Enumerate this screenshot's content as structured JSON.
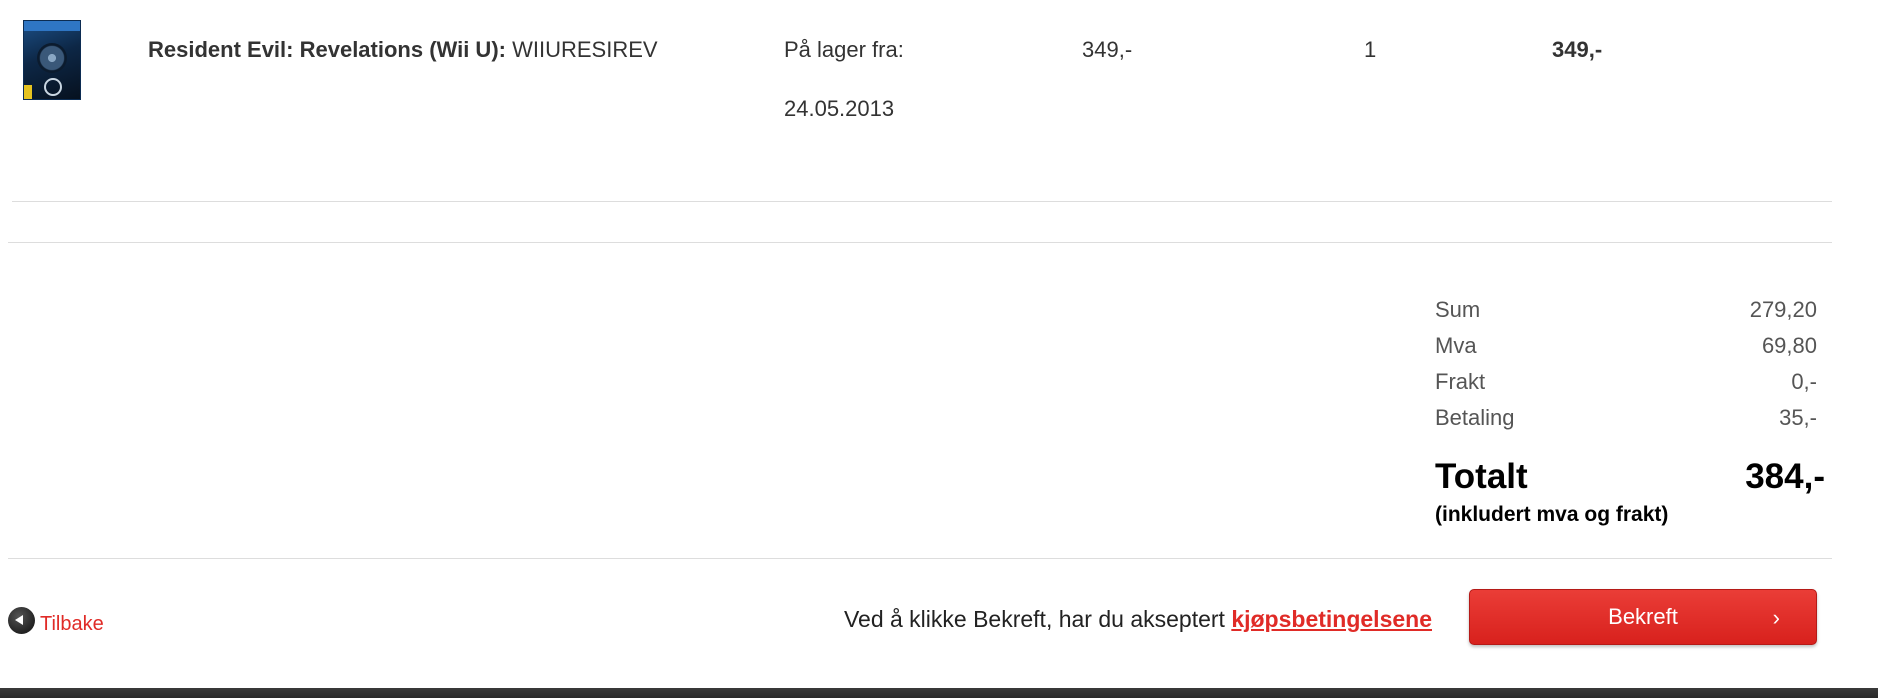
{
  "cart": {
    "item": {
      "name": "Resident Evil: Revelations (Wii U):",
      "sku": "WIIURESIREV",
      "stock_label": "På lager fra:",
      "stock_date": "24.05.2013",
      "unit_price": "349,-",
      "quantity": "1",
      "line_total": "349,-"
    }
  },
  "summary": {
    "rows": [
      {
        "label": "Sum",
        "value": "279,20"
      },
      {
        "label": "Mva",
        "value": "69,80"
      },
      {
        "label": "Frakt",
        "value": "0,-"
      },
      {
        "label": "Betaling",
        "value": "35,-"
      }
    ],
    "total_label": "Totalt",
    "total_value": "384,-",
    "total_note": "(inkludert mva og frakt)"
  },
  "actions": {
    "back_label": "Tilbake",
    "terms_text": "Ved å klikke Bekreft, har du akseptert ",
    "terms_link": "kjøpsbetingelsene",
    "confirm_label": "Bekreft",
    "confirm_chevron": "›"
  },
  "colors": {
    "accent": "#e02b27",
    "button": "#d8211d"
  }
}
